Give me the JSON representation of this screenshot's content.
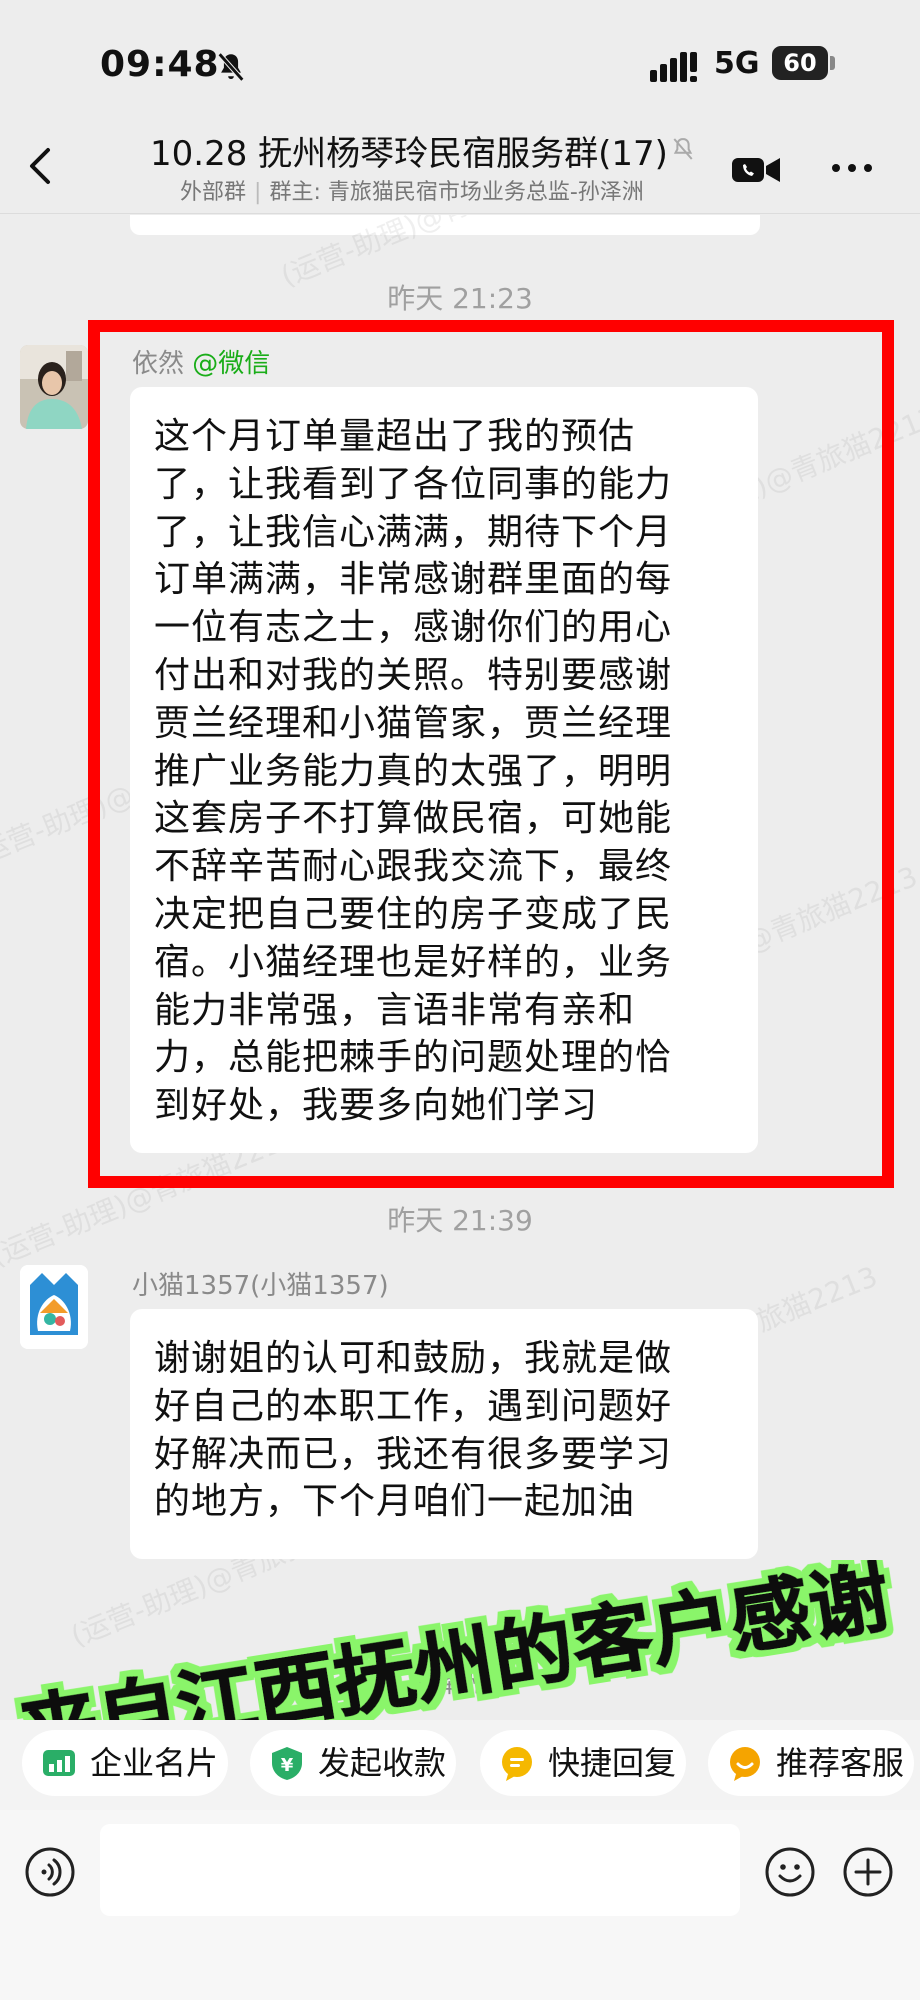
{
  "status_bar": {
    "time": "09:48",
    "network": "5G",
    "battery": "60"
  },
  "header": {
    "title": "10.28 抚州杨琴玲民宿服务群(17)",
    "subtitle_left": "外部群",
    "subtitle_right": "群主: 青旅猫民宿市场业务总监-孙泽洲"
  },
  "messages": [
    {
      "time": "昨天 21:23",
      "sender_name": "依然",
      "sender_suffix": "@微信",
      "text": "这个月订单量超出了我的预估\n了，让我看到了各位同事的能力\n了，让我信心满满，期待下个月\n订单满满，非常感谢群里面的每\n一位有志之士，感谢你们的用心\n付出和对我的关照。特别要感谢\n贾兰经理和小猫管家，贾兰经理\n推广业务能力真的太强了，明明\n这套房子不打算做民宿，可她能\n不辞辛苦耐心跟我交流下，最终\n决定把自己要住的房子变成了民\n宿。小猫经理也是好样的，业务\n能力非常强，言语非常有亲和\n力，总能把棘手的问题处理的恰\n到好处，我要多向她们学习"
    },
    {
      "time": "昨天 21:39",
      "sender_name": "小猫1357(小猫1357)",
      "text": "谢谢姐的认可和鼓励，我就是做\n好自己的本职工作，遇到问题好\n好解决而已，我还有很多要学习\n的地方，下个月咱们一起加油"
    },
    {
      "sender_name": "总监-孙泽洲"
    }
  ],
  "overlay_caption": "来自江西抚州的客户感谢",
  "watermark": "(运营-助理)@青旅猫2213",
  "quick_actions": [
    {
      "label": "企业名片",
      "icon": "business-card-icon",
      "color": "#2aae67"
    },
    {
      "label": "发起收款",
      "icon": "payment-icon",
      "color": "#2aae67"
    },
    {
      "label": "快捷回复",
      "icon": "quick-reply-icon",
      "color": "#f5b800"
    },
    {
      "label": "推荐客服",
      "icon": "recommend-service-icon",
      "color": "#f5a400"
    }
  ],
  "input": {
    "placeholder": ""
  }
}
